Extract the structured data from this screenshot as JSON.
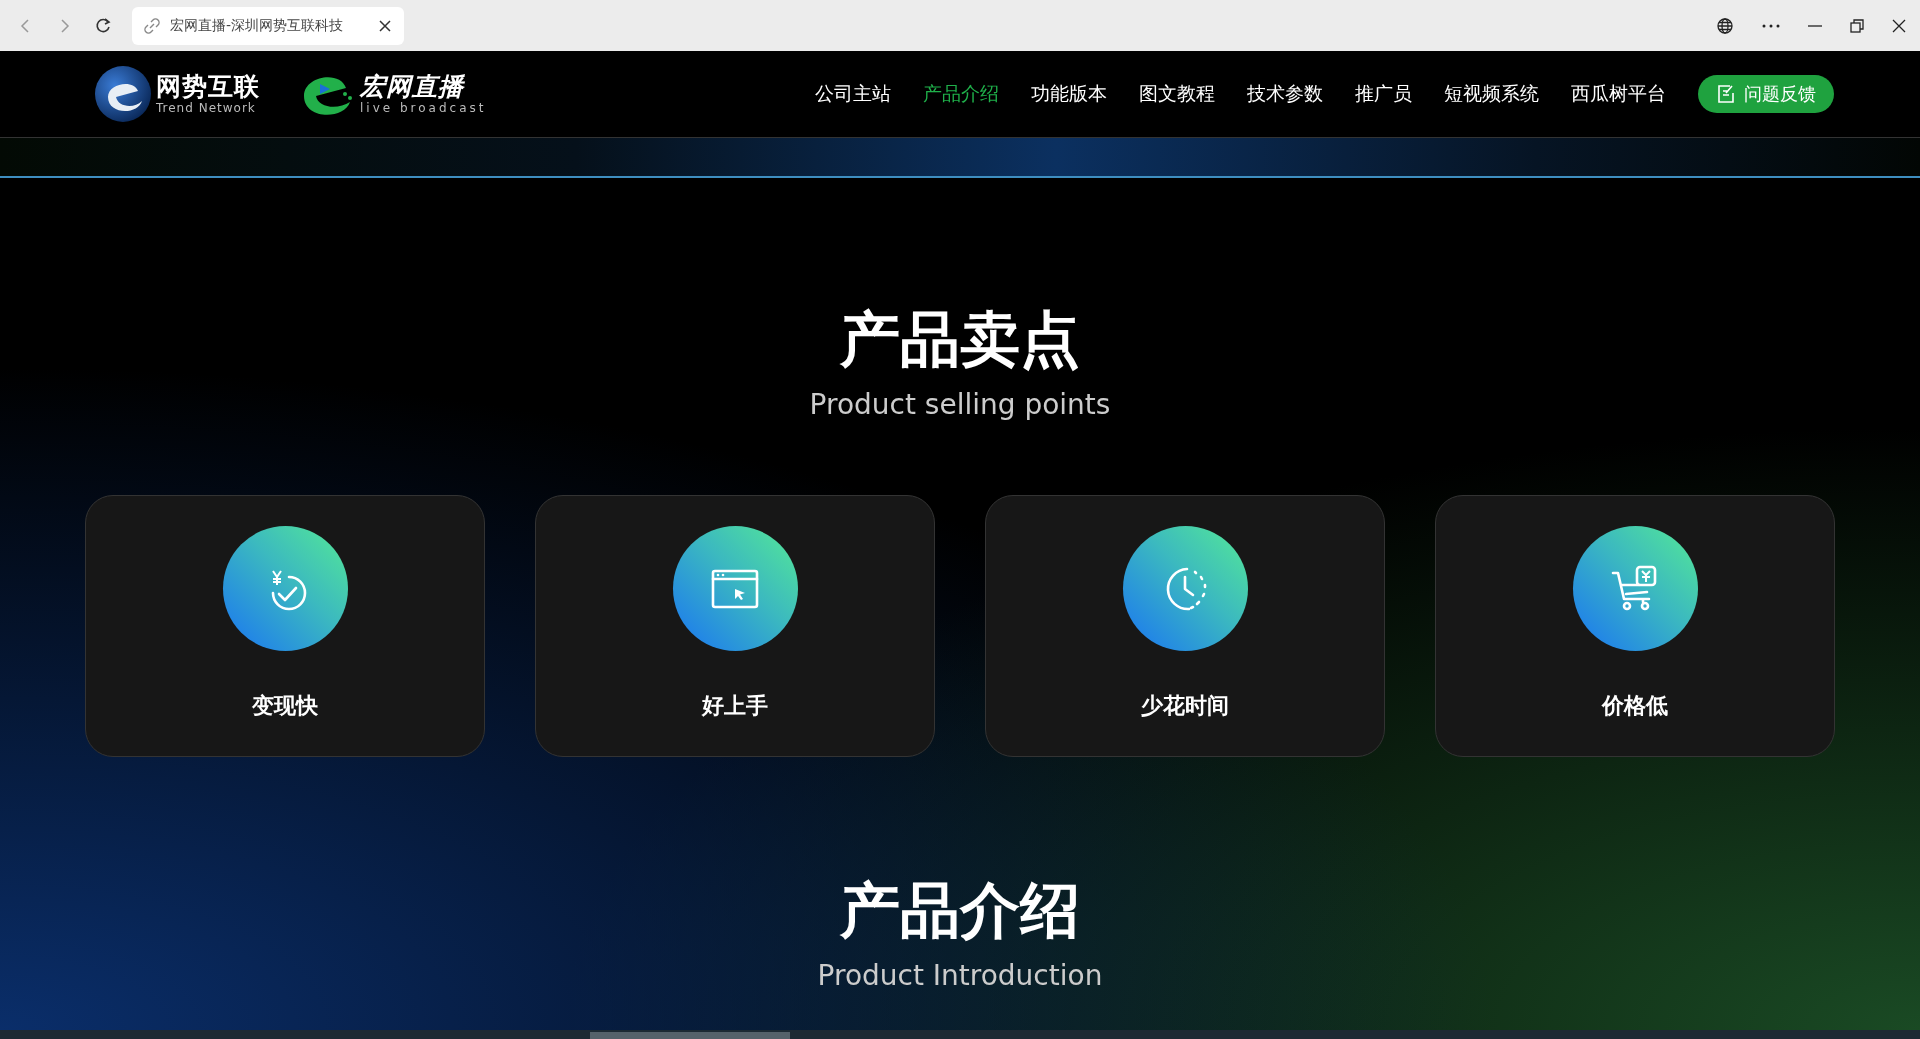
{
  "browser": {
    "tab_title": "宏网直播-深圳网势互联科技"
  },
  "header": {
    "logos": [
      {
        "kind": "trend",
        "name": "网势互联",
        "tagline": "Trend Network"
      },
      {
        "kind": "live",
        "name": "宏网直播",
        "tagline": "live broadcast"
      }
    ],
    "nav": [
      {
        "label": "公司主站",
        "selected": false
      },
      {
        "label": "产品介绍",
        "selected": true
      },
      {
        "label": "功能版本",
        "selected": false
      },
      {
        "label": "图文教程",
        "selected": false
      },
      {
        "label": "技术参数",
        "selected": false
      },
      {
        "label": "推广员",
        "selected": false
      },
      {
        "label": "短视频系统",
        "selected": false
      },
      {
        "label": "西瓜树平台",
        "selected": false
      }
    ],
    "feedback_button": "问题反馈"
  },
  "selling_points": {
    "title": "产品卖点",
    "subtitle": "Product selling points",
    "cards": [
      {
        "kind": "money",
        "label": "变现快"
      },
      {
        "kind": "window",
        "label": "好上手"
      },
      {
        "kind": "clock",
        "label": "少花时间"
      },
      {
        "kind": "cart",
        "label": "价格低"
      }
    ]
  },
  "introduction": {
    "title": "产品介绍",
    "subtitle": "Product Introduction"
  }
}
